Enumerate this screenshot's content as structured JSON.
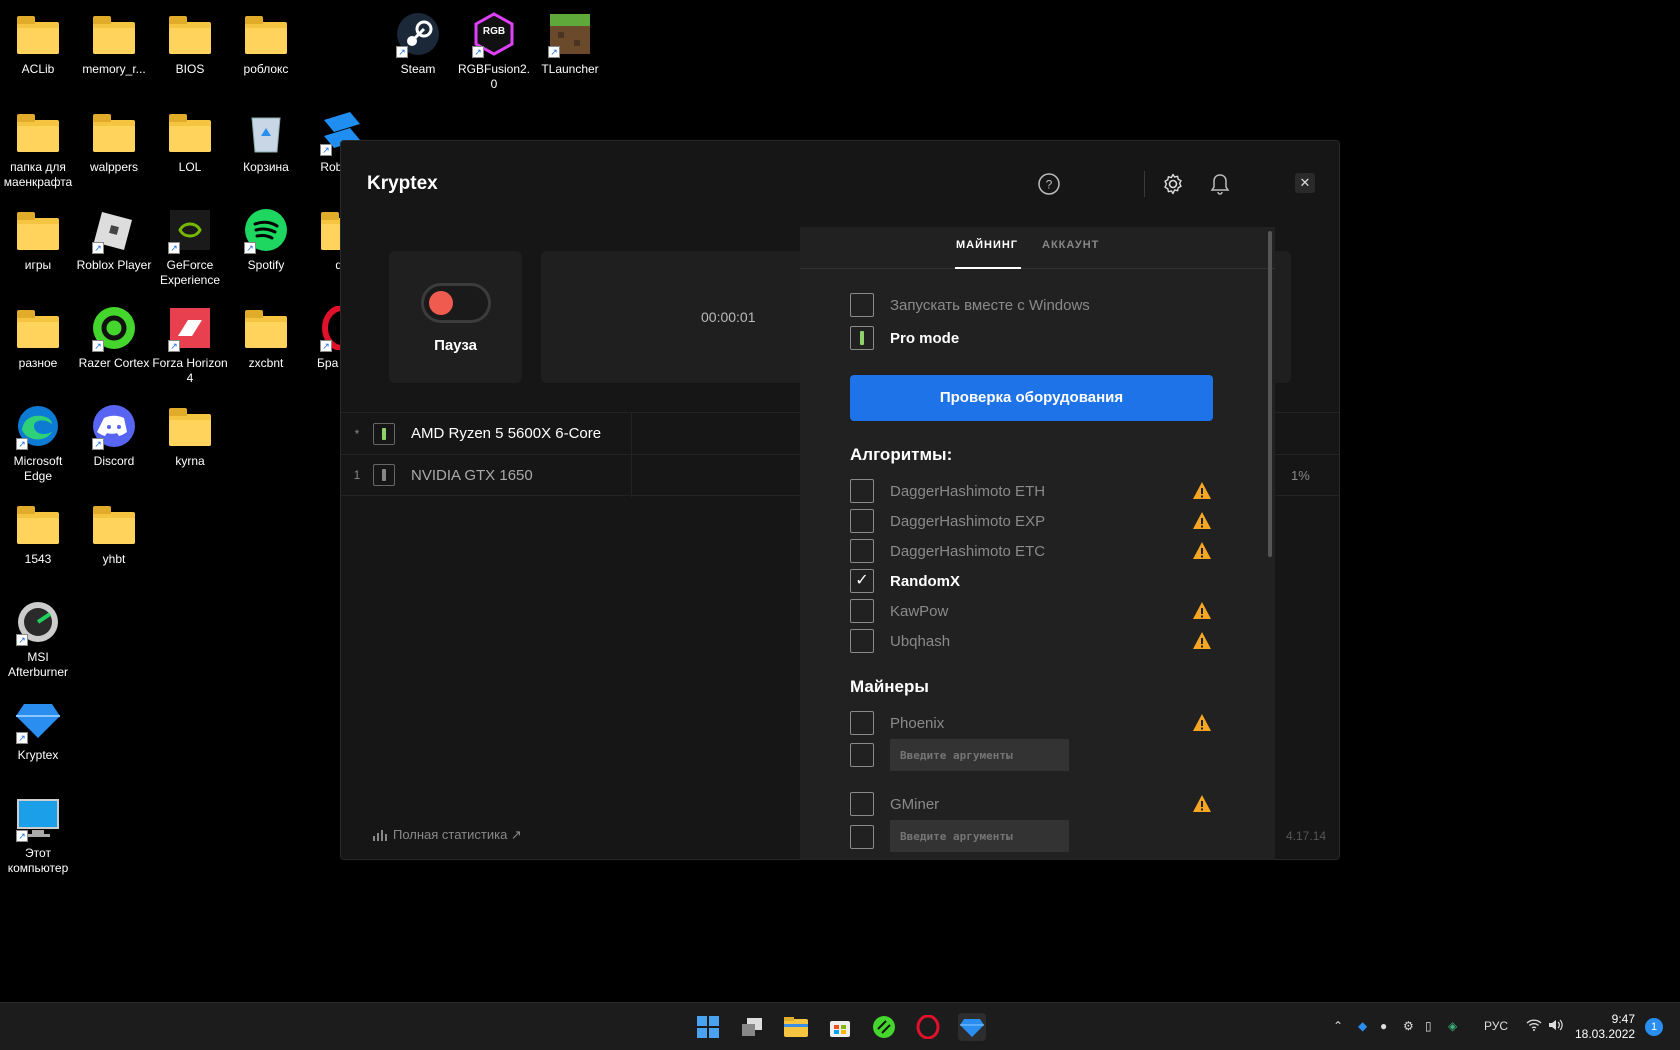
{
  "desktop": {
    "icons": [
      {
        "label": "ACLib",
        "icon": "folder-icon"
      },
      {
        "label": "memory_r...",
        "icon": "folder-icon"
      },
      {
        "label": "BIOS",
        "icon": "folder-icon"
      },
      {
        "label": "роблокс",
        "icon": "folder-icon"
      },
      {
        "label": "Steam",
        "icon": "steam-icon"
      },
      {
        "label": "RGBFusion2.0",
        "icon": "rgb-fusion-icon"
      },
      {
        "label": "TLauncher",
        "icon": "tlauncher-icon"
      },
      {
        "label": "папка для маенкрафта",
        "icon": "folder-icon"
      },
      {
        "label": "walppers",
        "icon": "folder-icon"
      },
      {
        "label": "LOL",
        "icon": "folder-icon"
      },
      {
        "label": "Корзина",
        "icon": "recycle-bin-icon"
      },
      {
        "label": "Rob Stu",
        "icon": "roblox-studio-icon"
      },
      {
        "label": "игры",
        "icon": "folder-icon"
      },
      {
        "label": "Roblox Player",
        "icon": "roblox-icon"
      },
      {
        "label": "GeForce Experience",
        "icon": "geforce-icon"
      },
      {
        "label": "Spotify",
        "icon": "spotify-icon"
      },
      {
        "label": "dh",
        "icon": "folder-icon"
      },
      {
        "label": "разное",
        "icon": "folder-icon"
      },
      {
        "label": "Razer Cortex",
        "icon": "razer-cortex-icon"
      },
      {
        "label": "Forza Horizon 4",
        "icon": "forza-icon"
      },
      {
        "label": "zxcbnt",
        "icon": "folder-icon"
      },
      {
        "label": "Бра Opel",
        "icon": "opera-icon"
      },
      {
        "label": "Microsoft Edge",
        "icon": "edge-icon"
      },
      {
        "label": "Discord",
        "icon": "discord-icon"
      },
      {
        "label": "kyrna",
        "icon": "folder-icon"
      },
      {
        "label": "1543",
        "icon": "folder-icon"
      },
      {
        "label": "yhbt",
        "icon": "folder-icon"
      },
      {
        "label": "MSI Afterburner",
        "icon": "msi-afterburner-icon"
      },
      {
        "label": "Kryptex",
        "icon": "kryptex-icon"
      },
      {
        "label": "Этот компьютер",
        "icon": "this-pc-icon"
      }
    ]
  },
  "app": {
    "title": "Kryptex",
    "pause_label": "Пауза",
    "timer": "00:00:01",
    "devices": [
      {
        "index": "*",
        "name": "AMD Ryzen 5 5600X 6-Core"
      },
      {
        "index": "1",
        "name": "NVIDIA GTX 1650"
      }
    ],
    "gpu_percent": "1%",
    "stats_link": "Полная статистика ↗",
    "version": "4.17.14"
  },
  "settings": {
    "tabs": [
      {
        "label": "МАЙНИНГ"
      },
      {
        "label": "АККАУНТ"
      }
    ],
    "autostart_label": "Запускать вместе с Windows",
    "pro_mode_label": "Pro mode",
    "check_button": "Проверка оборудования",
    "algorithms_title": "Алгоритмы:",
    "algorithms": [
      {
        "label": "DaggerHashimoto ETH"
      },
      {
        "label": "DaggerHashimoto EXP"
      },
      {
        "label": "DaggerHashimoto ETC"
      },
      {
        "label": "RandomX"
      },
      {
        "label": "KawPow"
      },
      {
        "label": "Ubqhash"
      }
    ],
    "miners_title": "Майнеры",
    "miners": [
      {
        "label": "Phoenix",
        "args_placeholder": "Введите аргументы"
      },
      {
        "label": "GMiner",
        "args_placeholder": "Введите аргументы"
      }
    ]
  },
  "taskbar": {
    "language": "РУС",
    "time": "9:47",
    "date": "18.03.2022",
    "notifications": "1"
  }
}
